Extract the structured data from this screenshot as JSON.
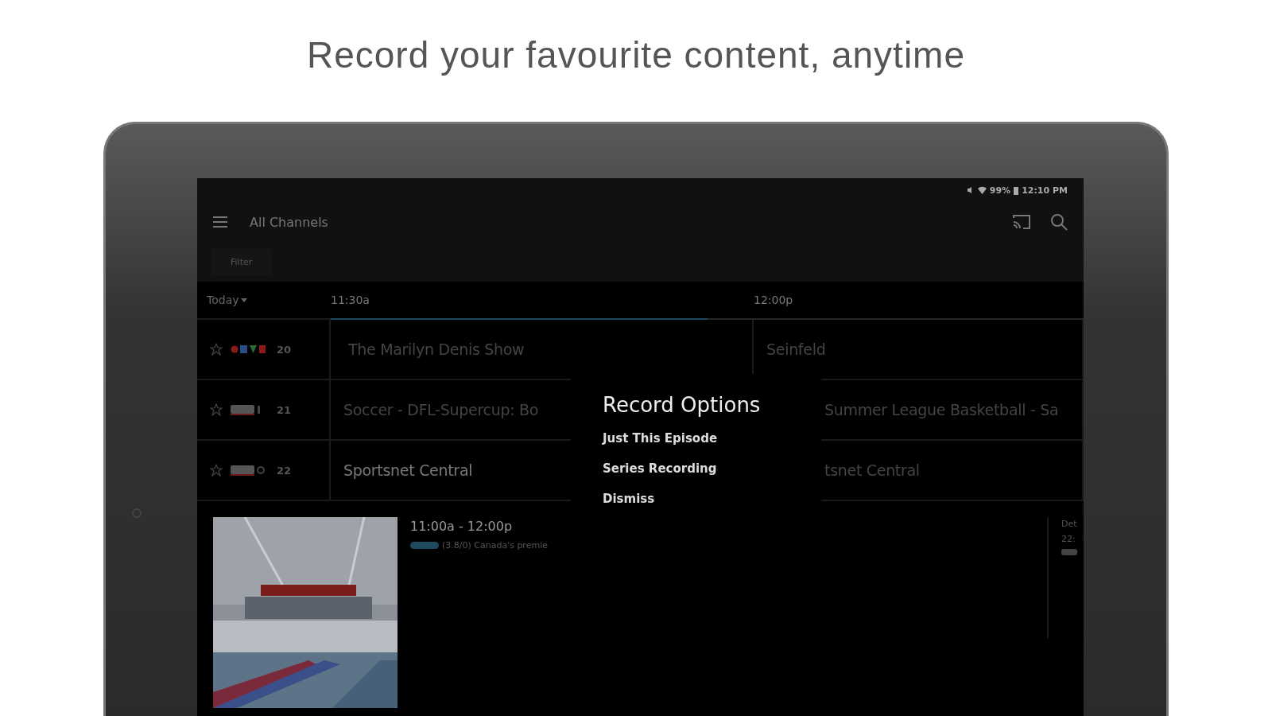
{
  "headline": "Record your favourite content, anytime",
  "status_bar": {
    "battery": "99%",
    "time": "12:10 PM"
  },
  "toolbar": {
    "title": "All Channels"
  },
  "filter": {
    "label": "Filter"
  },
  "guide": {
    "day": "Today",
    "times": [
      "11:30a",
      "12:00p"
    ],
    "progress": {
      "level": 0.5
    },
    "channels": [
      {
        "kind": "ctv2",
        "number": "20",
        "programs": [
          {
            "title": "The Marilyn Denis Show",
            "selected": false
          },
          {
            "title": "Seinfeld",
            "selected": false
          }
        ]
      },
      {
        "kind": "sn1",
        "number": "21",
        "programs": [
          {
            "title": "Soccer - DFL-Supercup: Bo",
            "selected": false
          },
          {
            "title": "Summer League Basketball - Sa",
            "selected": false
          }
        ]
      },
      {
        "kind": "sn0",
        "number": "22",
        "programs": [
          {
            "title": "Sportsnet Central",
            "selected": true
          },
          {
            "title": "tsnet Central",
            "selected": false
          }
        ]
      }
    ]
  },
  "dialog": {
    "title": "Record Options",
    "options": [
      "Just This Episode",
      "Series Recording",
      "Dismiss"
    ]
  },
  "detail": {
    "time": "11:00a - 12:00p",
    "description": "(3.8/0) Canada's premie",
    "side": [
      "Det",
      "22:"
    ]
  }
}
